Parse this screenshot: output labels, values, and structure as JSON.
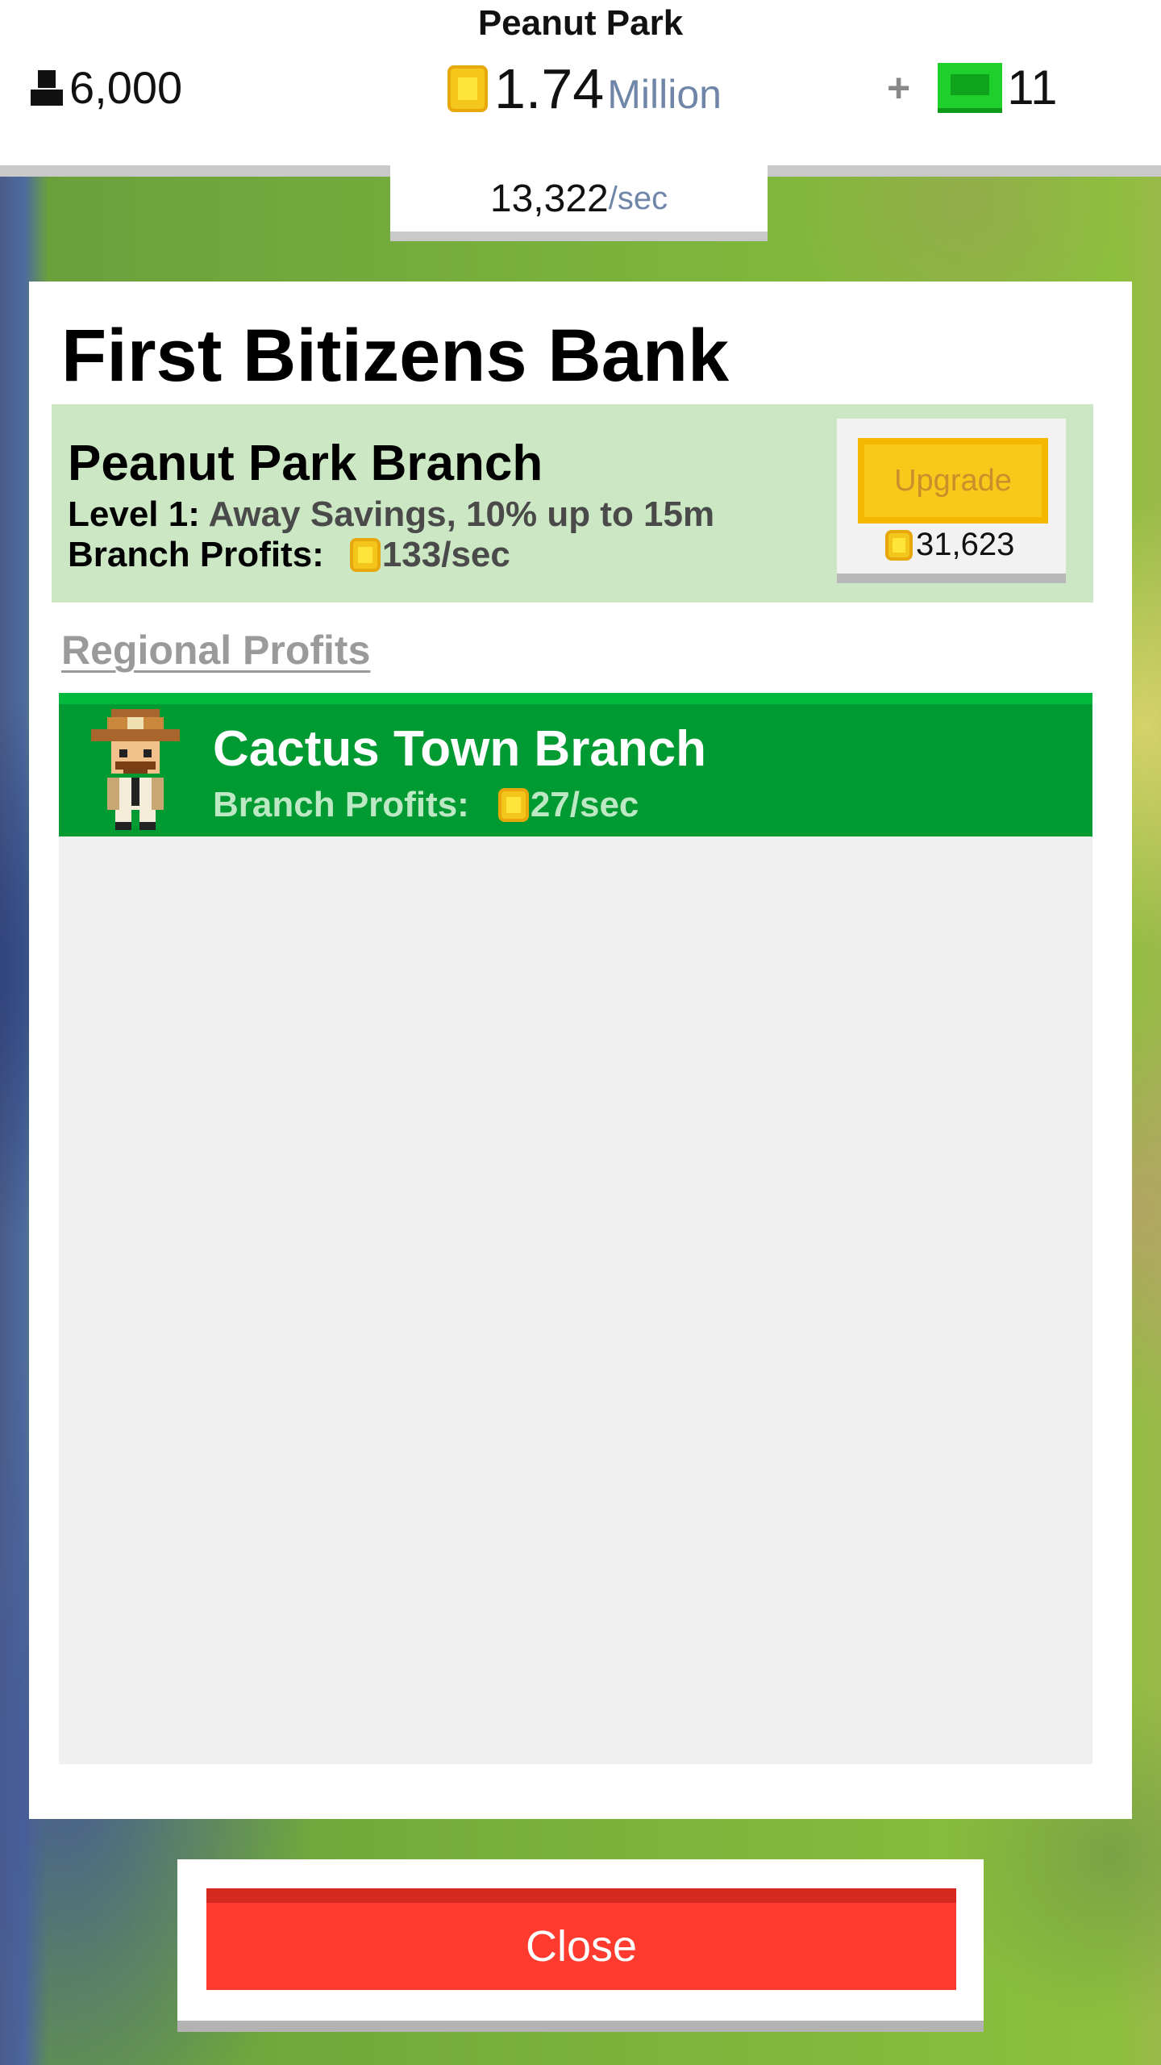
{
  "header": {
    "city_name": "Peanut Park",
    "population": "6,000",
    "coins": "1.74",
    "coins_unit": "Million",
    "plus": "+",
    "bux": "11",
    "rate_value": "13,322",
    "rate_unit": "/sec"
  },
  "bank": {
    "title": "First Bitizens Bank",
    "branch": {
      "name": "Peanut Park Branch",
      "level_label": "Level 1:",
      "level_desc": "Away Savings, 10% up to 15m",
      "profits_label": "Branch Profits:",
      "profits_value": "133/sec",
      "upgrade_label": "Upgrade",
      "upgrade_cost": "31,623"
    },
    "regional": {
      "label": "Regional Profits",
      "items": [
        {
          "name": "Cactus Town Branch",
          "profits_label": "Branch Profits:",
          "profits_value": "27/sec"
        }
      ]
    },
    "close_label": "Close"
  },
  "colors": {
    "accent_green": "#009a32",
    "upgrade_yellow": "#f8c81a",
    "close_red": "#ff3b30",
    "branch_card_bg": "#cce7c3"
  },
  "icons": {
    "population": "person-icon",
    "coin": "coin-icon",
    "bux": "bux-icon",
    "avatar": "sheriff-avatar-icon"
  }
}
